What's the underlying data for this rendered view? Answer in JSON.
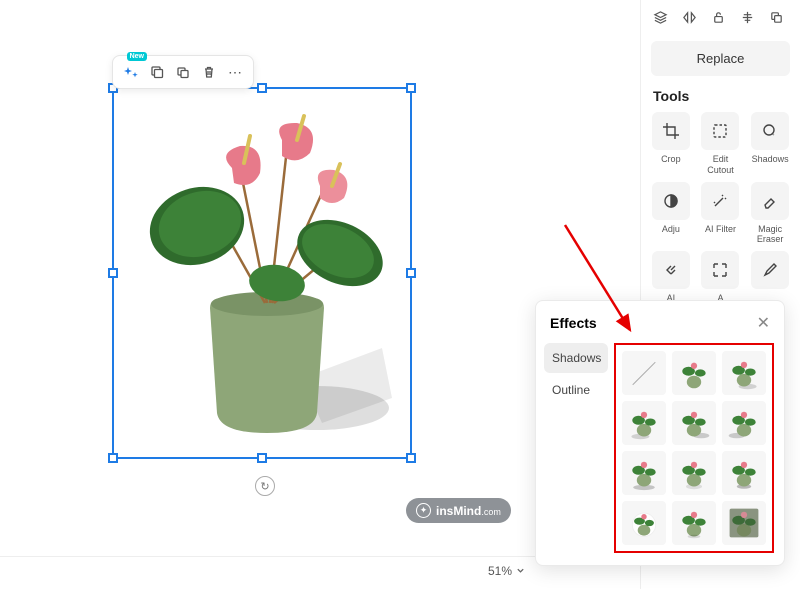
{
  "toolbar": {
    "new_badge": "New"
  },
  "watermark": {
    "brand": "insMind",
    "suffix": ".com"
  },
  "zoom": {
    "value": "51%"
  },
  "rail": {
    "replace_label": "Replace",
    "tools_title": "Tools",
    "tool_crop": "Crop",
    "tool_edit_cutout": "Edit\nCutout",
    "tool_shadows": "Shadows",
    "tool_adjust": "Adju",
    "tool_ai_filter": "AI Filter",
    "tool_magic_eraser": "Magic\nEraser",
    "tool_ai_enhancer": "AI\nEnhancer",
    "tool_ai_extend": "A\nExten"
  },
  "effects": {
    "title": "Effects",
    "tab_shadows": "Shadows",
    "tab_outline": "Outline"
  }
}
